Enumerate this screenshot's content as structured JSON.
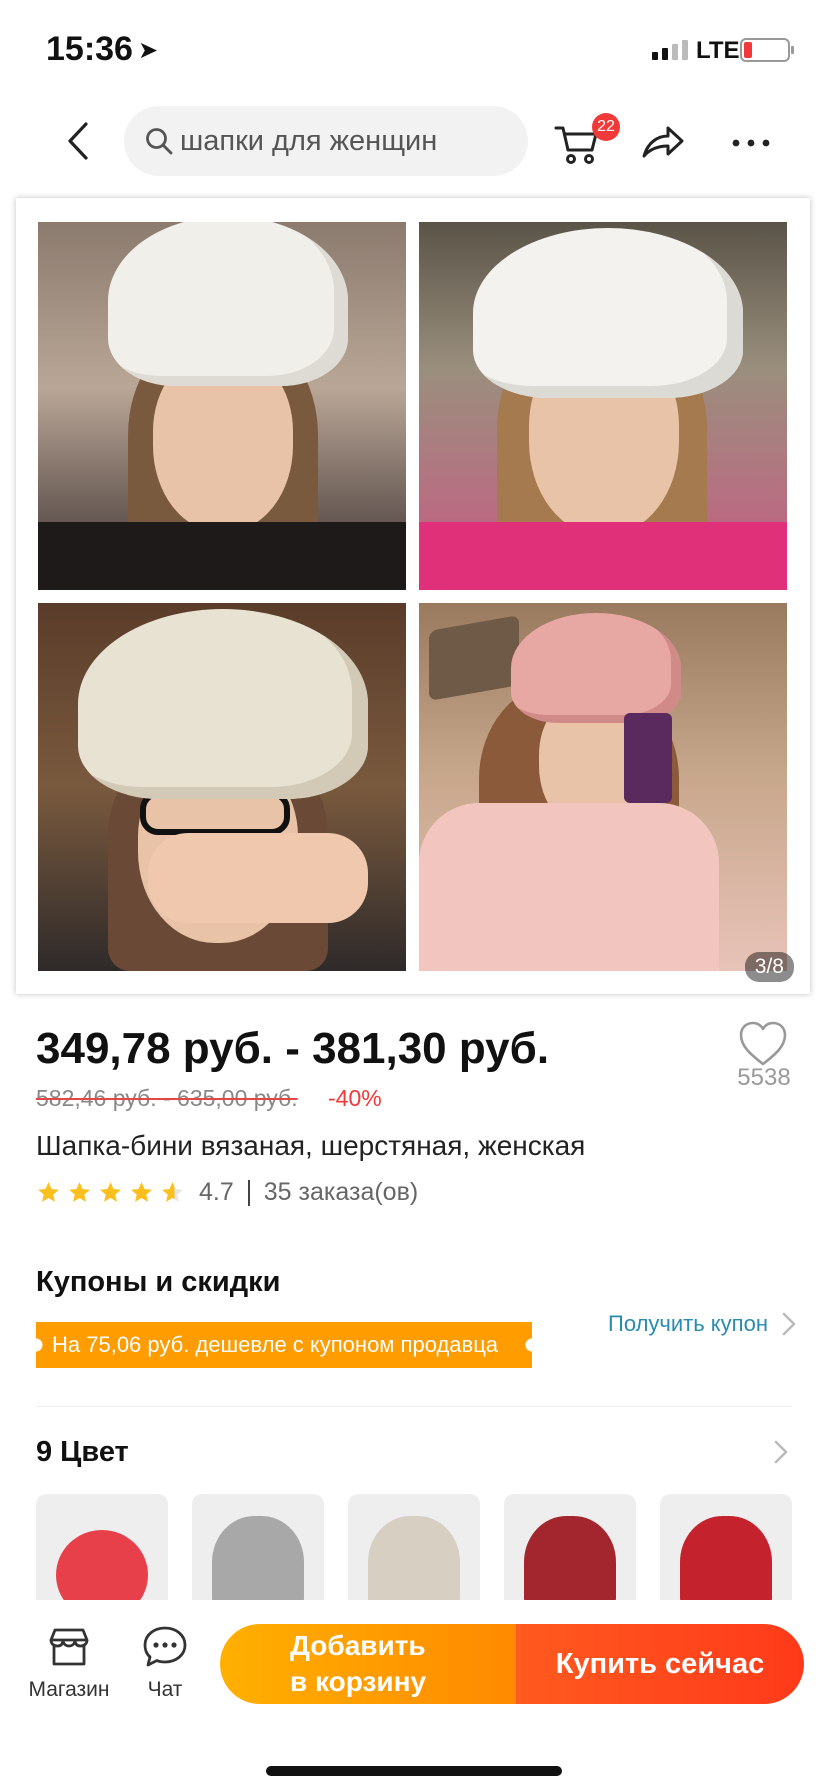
{
  "status_bar": {
    "time": "15:36",
    "network": "LTE"
  },
  "search": {
    "placeholder": "шапки для женщин"
  },
  "header": {
    "cart_count": "22"
  },
  "gallery": {
    "counter": "3/8"
  },
  "product": {
    "price": "349,78 руб. - 381,30 руб.",
    "old_price": "582,46 руб. - 635,00 руб.",
    "discount": "-40%",
    "wishlist_count": "5538",
    "title": "Шапка-бини вязаная, шерстяная, женская",
    "rating": "4.7",
    "rating_fraction": 0.94,
    "orders": "35 заказа(ов)"
  },
  "coupons": {
    "title": "Купоны и скидки",
    "banner": "На 75,06 руб. дешевле с купоном продавца",
    "link": "Получить купон"
  },
  "colors": {
    "title": "9 Цвет",
    "swatch_colors": [
      "#e8404a",
      "#a8a8a8",
      "#d6cfc2",
      "#a3262e",
      "#c4222c"
    ]
  },
  "bottom_bar": {
    "store_label": "Магазин",
    "chat_label": "Чат",
    "add_to_cart_line1": "Добавить",
    "add_to_cart_line2": "в корзину",
    "buy_now": "Купить сейчас"
  },
  "theme": {
    "accent": "#ff9c00",
    "price_red": "#f03a3a",
    "link_blue": "#2a8bb0"
  }
}
